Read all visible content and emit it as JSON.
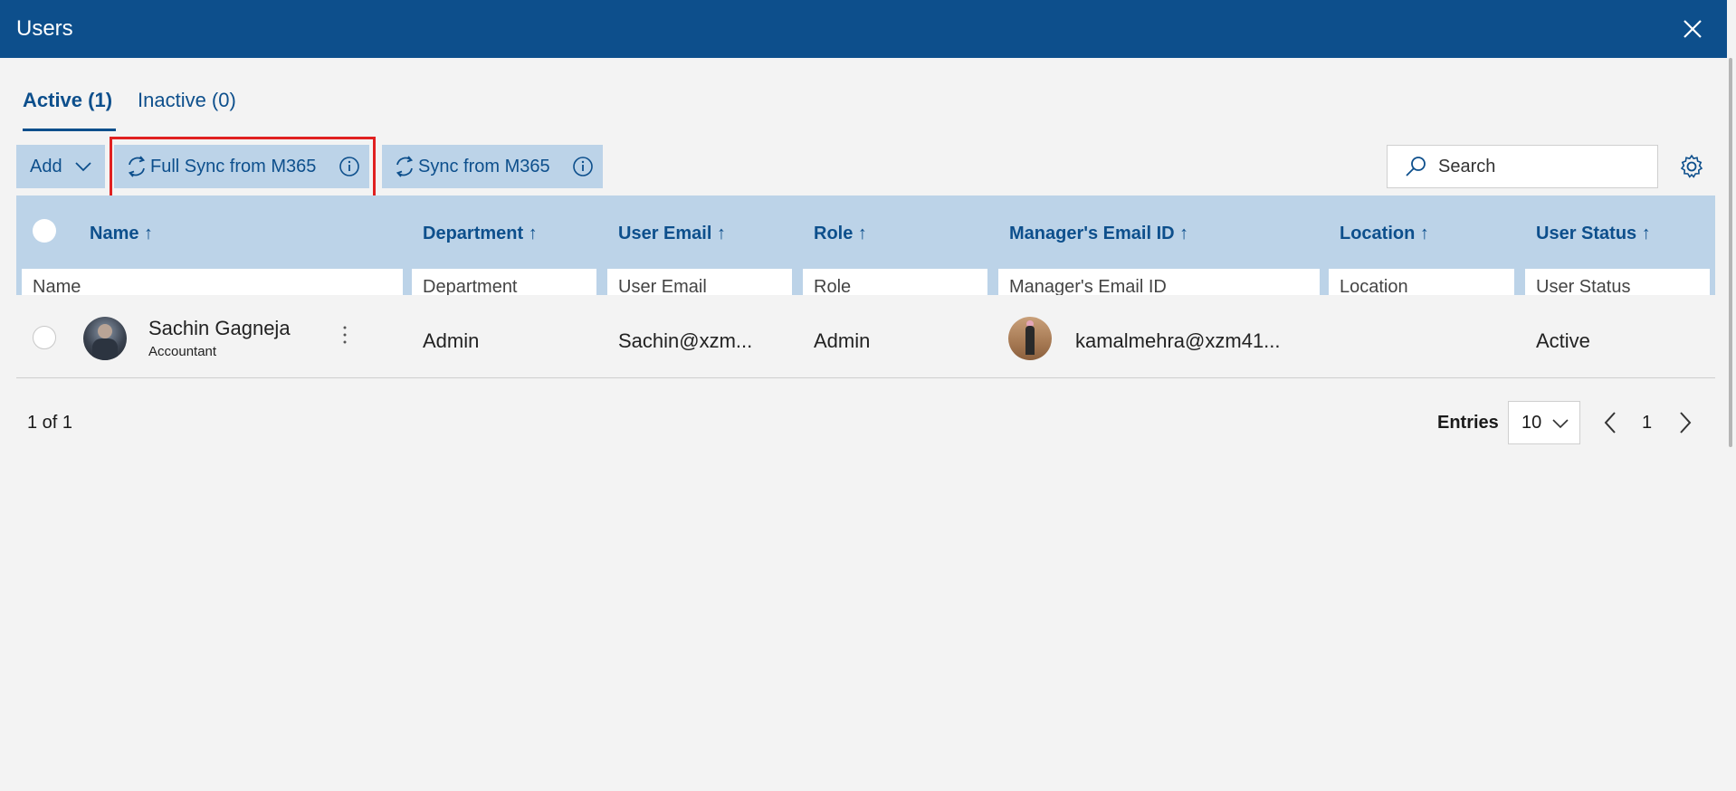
{
  "window": {
    "title": "Users"
  },
  "tabs": [
    {
      "label": "Active (1)"
    },
    {
      "label": "Inactive (0)"
    }
  ],
  "toolbar": {
    "add_label": "Add",
    "full_sync_label": "Full Sync from M365",
    "sync_label": "Sync from M365"
  },
  "search": {
    "placeholder": "Search"
  },
  "table": {
    "columns": [
      {
        "label": "Name ↑",
        "filter": "Name"
      },
      {
        "label": "Department ↑",
        "filter": "Department"
      },
      {
        "label": "User Email ↑",
        "filter": "User Email"
      },
      {
        "label": "Role ↑",
        "filter": "Role"
      },
      {
        "label": "Manager's Email ID ↑",
        "filter": "Manager's Email ID"
      },
      {
        "label": "Location ↑",
        "filter": "Location"
      },
      {
        "label": "User Status ↑",
        "filter": "User Status"
      }
    ],
    "rows": [
      {
        "name": "Sachin Gagneja",
        "title": "Accountant",
        "department": "Admin",
        "email": "Sachin@xzm...",
        "role": "Admin",
        "manager_email": "kamalmehra@xzm41...",
        "location": "",
        "status": "Active"
      }
    ]
  },
  "pagination": {
    "count_text": "1 of 1",
    "entries_label": "Entries",
    "entries_value": "10",
    "current_page": "1"
  },
  "colors": {
    "header_blue": "#0d4f8c",
    "light_blue": "#bcd3e8",
    "highlight_red": "#e02020"
  }
}
